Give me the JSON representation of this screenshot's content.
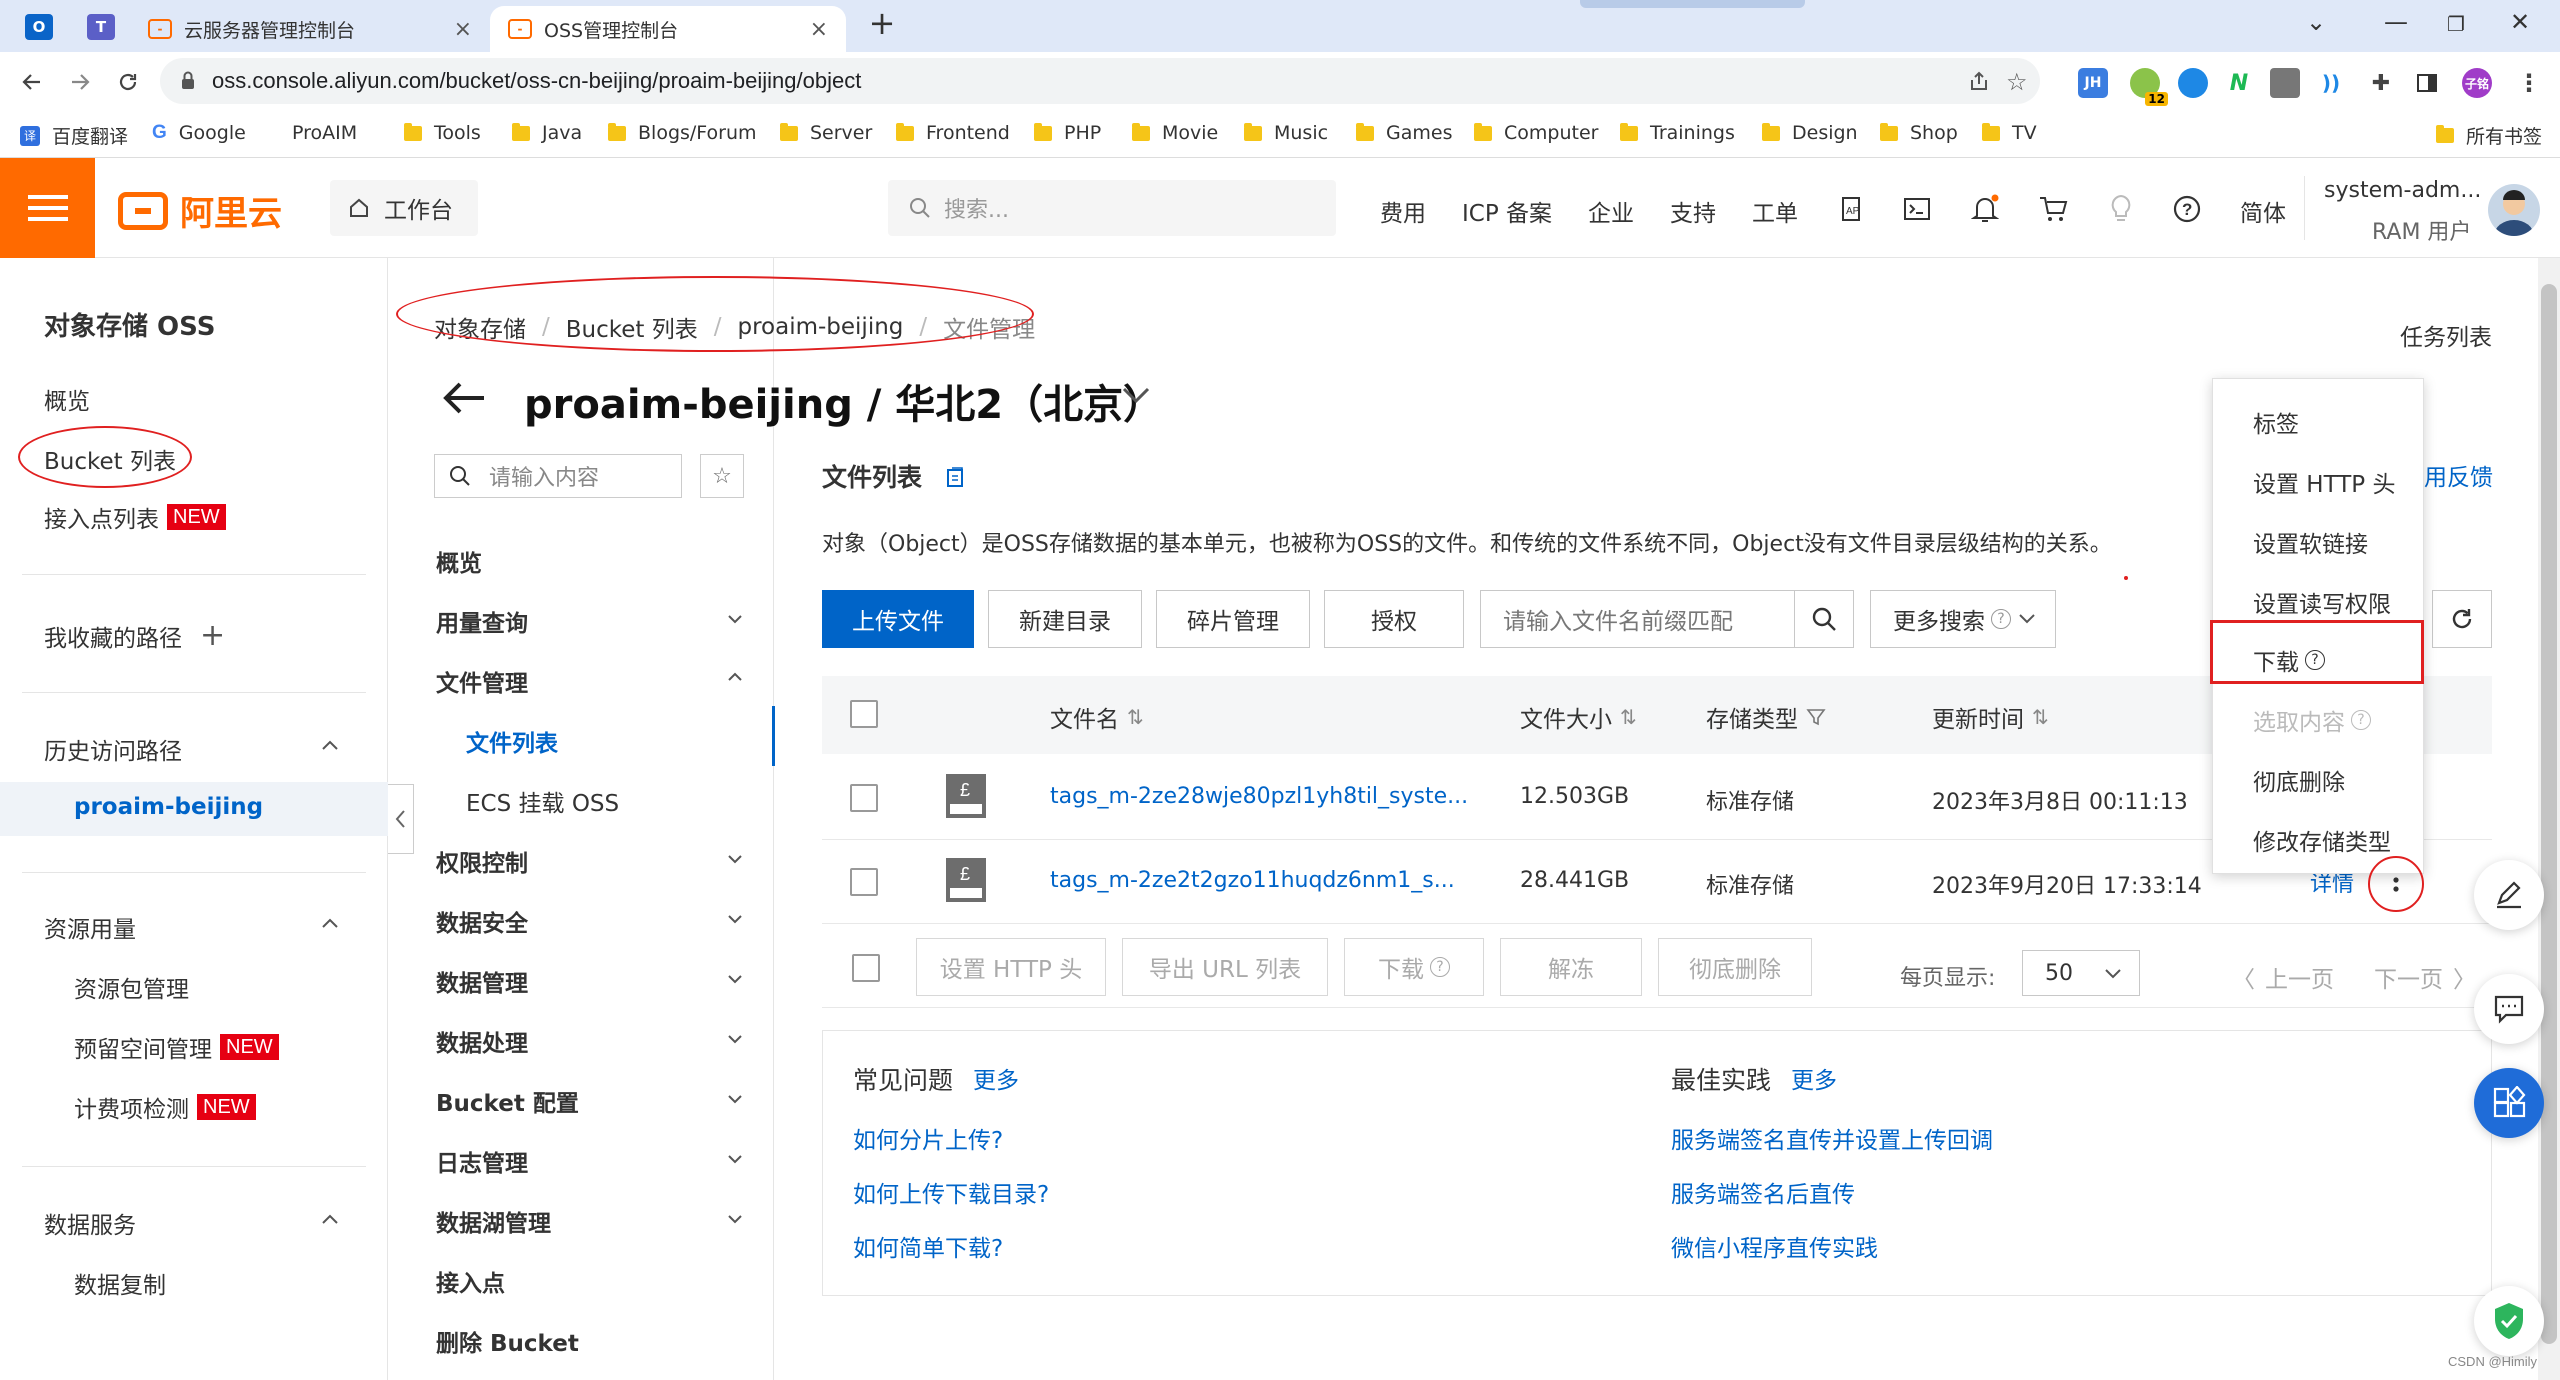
{
  "browser": {
    "tabs": [
      {
        "title": "云服务器管理控制台",
        "active": false
      },
      {
        "title": "OSS管理控制台",
        "active": true
      }
    ],
    "url": "oss.console.aliyun.com/bucket/oss-cn-beijing/proaim-beijing/object",
    "extensions": {
      "badge_count": "12",
      "avatar_label": "子铭"
    },
    "bookmarks": [
      "百度翻译",
      "Google",
      "ProAIM",
      "Tools",
      "Java",
      "Blogs/Forum",
      "Server",
      "Frontend",
      "PHP",
      "Movie",
      "Music",
      "Games",
      "Computer",
      "Trainings",
      "Design",
      "Shop",
      "TV"
    ],
    "all_bookmarks": "所有书签"
  },
  "header": {
    "logo_text": "阿里云",
    "workbench": "工作台",
    "search_placeholder": "搜索...",
    "nav": [
      "费用",
      "ICP 备案",
      "企业",
      "支持",
      "工单"
    ],
    "lang": "简体",
    "user_name": "system-adm...",
    "user_role": "RAM 用户"
  },
  "sidebar": {
    "title": "对象存储 OSS",
    "overview": "概览",
    "bucket_list": "Bucket 列表",
    "access_points": "接入点列表",
    "new_badge": "NEW",
    "favorites": "我收藏的路径",
    "history": "历史访问路径",
    "history_item": "proaim-beijing",
    "resource_usage": "资源用量",
    "resource_pkg": "资源包管理",
    "reserved_space": "预留空间管理",
    "billing_check": "计费项检测",
    "data_service": "数据服务",
    "data_copy": "数据复制"
  },
  "subnav": {
    "search_placeholder": "请输入内容",
    "items": [
      "概览",
      "用量查询",
      "文件管理",
      "文件列表",
      "ECS 挂载 OSS",
      "权限控制",
      "数据安全",
      "数据管理",
      "数据处理",
      "Bucket 配置",
      "日志管理",
      "数据湖管理",
      "接入点",
      "删除 Bucket"
    ]
  },
  "main": {
    "breadcrumb": [
      "对象存储",
      "Bucket 列表",
      "proaim-beijing",
      "文件管理"
    ],
    "task_list": "任务列表",
    "title": "proaim-beijing / 华北2（北京）",
    "files_heading": "文件列表",
    "feedback": "用反馈",
    "description": "对象（Object）是OSS存储数据的基本单元，也被称为OSS的文件。和传统的文件系统不同，Object没有文件目录层级结构的关系。",
    "buttons": {
      "upload": "上传文件",
      "new_dir": "新建目录",
      "fragments": "碎片管理",
      "authorize": "授权"
    },
    "filter_placeholder": "请输入文件名前缀匹配",
    "more_search": "更多搜索",
    "columns": {
      "name": "文件名",
      "size": "文件大小",
      "storage": "存储类型",
      "updated": "更新时间"
    },
    "rows": [
      {
        "name": "tags_m-2ze28wje80pzl1yh8til_syste...",
        "size": "12.503GB",
        "storage": "标准存储",
        "updated": "2023年3月8日 00:11:13"
      },
      {
        "name": "tags_m-2ze2t2gzo11huqdz6nm1_s...",
        "size": "28.441GB",
        "storage": "标准存储",
        "updated": "2023年9月20日 17:33:14"
      }
    ],
    "row_details": "详情",
    "batch": {
      "http_header": "设置 HTTP 头",
      "export_url": "导出 URL 列表",
      "download": "下载",
      "unfreeze": "解冻",
      "delete": "彻底删除"
    },
    "per_page_label": "每页显示:",
    "per_page": "50",
    "prev": "上一页",
    "next": "下一页",
    "faq": {
      "title": "常见问题",
      "more": "更多",
      "links": [
        "如何分片上传?",
        "如何上传下载目录?",
        "如何简单下载?"
      ]
    },
    "best": {
      "title": "最佳实践",
      "more": "更多",
      "links": [
        "服务端签名直传并设置上传回调",
        "服务端签名后直传",
        "微信小程序直传实践"
      ]
    }
  },
  "dropdown": {
    "items": [
      {
        "label": "标签",
        "disabled": false
      },
      {
        "label": "设置 HTTP 头",
        "disabled": false
      },
      {
        "label": "设置软链接",
        "disabled": false
      },
      {
        "label": "设置读写权限",
        "disabled": false
      },
      {
        "label": "下载",
        "disabled": false
      },
      {
        "label": "选取内容",
        "disabled": true
      },
      {
        "label": "彻底删除",
        "disabled": false
      },
      {
        "label": "修改存储类型",
        "disabled": false
      }
    ]
  },
  "watermark": "CSDN @Himily",
  "colors": {
    "brand_orange": "#ff6a00",
    "primary_blue": "#0064c8",
    "annotation_red": "#e02020",
    "new_red": "#e60012"
  }
}
